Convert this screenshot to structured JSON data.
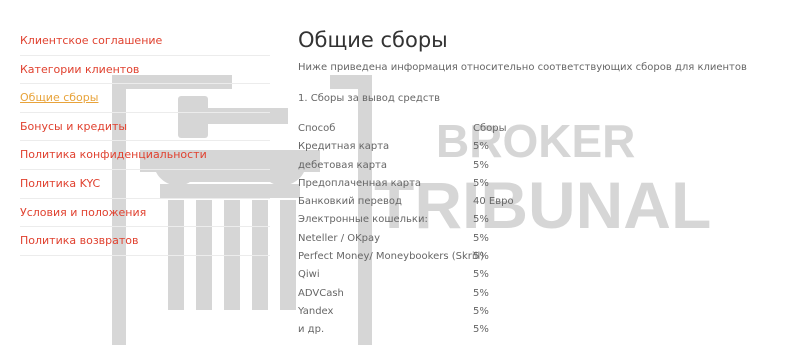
{
  "sidebar": {
    "items": [
      {
        "label": "Клиентское соглашение",
        "active": false
      },
      {
        "label": "Категории клиентов",
        "active": false
      },
      {
        "label": "Общие сборы",
        "active": true
      },
      {
        "label": "Бонусы и кредиты",
        "active": false
      },
      {
        "label": "Политика конфиденциальности",
        "active": false
      },
      {
        "label": "Политика KYC",
        "active": false
      },
      {
        "label": "Условия и положения",
        "active": false
      },
      {
        "label": "Политика возвратов",
        "active": false
      }
    ]
  },
  "main": {
    "title": "Общие сборы",
    "intro": "Ниже приведена информация относительно соответствующих сборов для клиентов",
    "section_title": "1. Сборы за вывод средств",
    "fees_table": {
      "headers": {
        "method": "Способ",
        "fee": "Сборы"
      },
      "rows": [
        {
          "method": "Кредитная карта",
          "fee": "5%"
        },
        {
          "method": "дебетовая карта",
          "fee": "5%"
        },
        {
          "method": "Предоплаченная карта",
          "fee": "5%"
        },
        {
          "method": "Банковкий перевод",
          "fee": "40 Евро"
        },
        {
          "method": "Электронные кошельки:",
          "fee": "5%"
        },
        {
          "method": "Neteller / OKpay",
          "fee": "5%"
        },
        {
          "method": "Perfect Money/ Moneybookers (Skrill)",
          "fee": "5%"
        },
        {
          "method": "Qiwi",
          "fee": "5%"
        },
        {
          "method": "ADVCash",
          "fee": "5%"
        },
        {
          "method": "Yandex",
          "fee": "5%"
        },
        {
          "method": "и др.",
          "fee": "5%"
        }
      ]
    }
  },
  "watermark": {
    "line1": "BROKER",
    "line2": "TRIBUNAL",
    "icon": "gavel-pillar-icon",
    "color": "#d3d3d3"
  },
  "colors": {
    "link": "#e0412f",
    "active_link": "#e8a33a",
    "text": "#666666",
    "title": "#333333"
  }
}
